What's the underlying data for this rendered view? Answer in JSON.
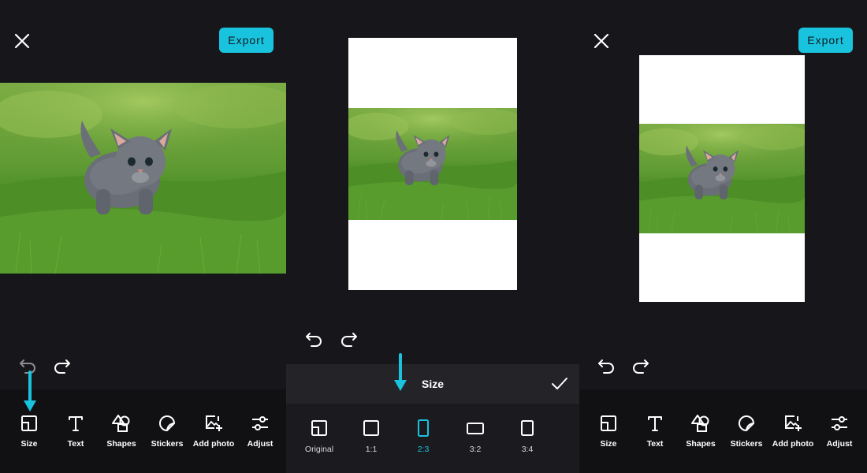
{
  "colors": {
    "accent": "#19c3de",
    "background": "#17171b",
    "canvas": "#ffffff"
  },
  "export_label": "Export",
  "toolbar": {
    "items": [
      {
        "label": "Size",
        "icon": "size-icon"
      },
      {
        "label": "Text",
        "icon": "text-icon"
      },
      {
        "label": "Shapes",
        "icon": "shapes-icon"
      },
      {
        "label": "Stickers",
        "icon": "stickers-icon"
      },
      {
        "label": "Add photo",
        "icon": "add-photo-icon"
      },
      {
        "label": "Adjust",
        "icon": "adjust-icon"
      }
    ]
  },
  "size_panel": {
    "title": "Size",
    "options": [
      {
        "label": "Original",
        "icon": "original-ratio-icon"
      },
      {
        "label": "1:1",
        "icon": "square-ratio-icon"
      },
      {
        "label": "2:3",
        "icon": "portrait-ratio-icon",
        "selected": true
      },
      {
        "label": "3:2",
        "icon": "landscape-ratio-icon"
      },
      {
        "label": "3:4",
        "icon": "portrait-3-4-ratio-icon"
      }
    ]
  }
}
